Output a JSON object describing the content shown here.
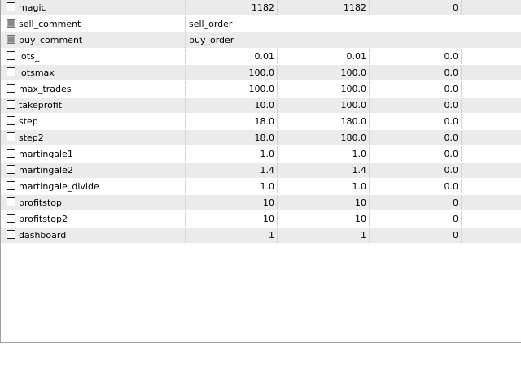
{
  "rows": [
    {
      "name": "magic",
      "value": "1182",
      "start": "1182",
      "step": "0",
      "stop": "",
      "kind": "num",
      "checkbox": "enabled",
      "shaded": true
    },
    {
      "name": "sell_comment",
      "value": "sell_order",
      "start": "",
      "step": "",
      "stop": "",
      "kind": "text",
      "checkbox": "disabled",
      "shaded": false
    },
    {
      "name": "buy_comment",
      "value": "buy_order",
      "start": "",
      "step": "",
      "stop": "",
      "kind": "text",
      "checkbox": "disabled",
      "shaded": true
    },
    {
      "name": "lots_",
      "value": "0.01",
      "start": "0.01",
      "step": "0.0",
      "stop": "",
      "kind": "num",
      "checkbox": "enabled",
      "shaded": false
    },
    {
      "name": "lotsmax",
      "value": "100.0",
      "start": "100.0",
      "step": "0.0",
      "stop": "",
      "kind": "num",
      "checkbox": "enabled",
      "shaded": true
    },
    {
      "name": "max_trades",
      "value": "100.0",
      "start": "100.0",
      "step": "0.0",
      "stop": "",
      "kind": "num",
      "checkbox": "enabled",
      "shaded": false
    },
    {
      "name": "takeprofit",
      "value": "10.0",
      "start": "100.0",
      "step": "0.0",
      "stop": "",
      "kind": "num",
      "checkbox": "enabled",
      "shaded": true
    },
    {
      "name": "step",
      "value": "18.0",
      "start": "180.0",
      "step": "0.0",
      "stop": "",
      "kind": "num",
      "checkbox": "enabled",
      "shaded": false
    },
    {
      "name": "step2",
      "value": "18.0",
      "start": "180.0",
      "step": "0.0",
      "stop": "",
      "kind": "num",
      "checkbox": "enabled",
      "shaded": true
    },
    {
      "name": "martingale1",
      "value": "1.0",
      "start": "1.0",
      "step": "0.0",
      "stop": "",
      "kind": "num",
      "checkbox": "enabled",
      "shaded": false
    },
    {
      "name": "martingale2",
      "value": "1.4",
      "start": "1.4",
      "step": "0.0",
      "stop": "",
      "kind": "num",
      "checkbox": "enabled",
      "shaded": true
    },
    {
      "name": "martingale_divide",
      "value": "1.0",
      "start": "1.0",
      "step": "0.0",
      "stop": "",
      "kind": "num",
      "checkbox": "enabled",
      "shaded": false
    },
    {
      "name": "profitstop",
      "value": "10",
      "start": "10",
      "step": "0",
      "stop": "",
      "kind": "num",
      "checkbox": "enabled",
      "shaded": true
    },
    {
      "name": "profitstop2",
      "value": "10",
      "start": "10",
      "step": "0",
      "stop": "",
      "kind": "num",
      "checkbox": "enabled",
      "shaded": false
    },
    {
      "name": "dashboard",
      "value": "1",
      "start": "1",
      "step": "0",
      "stop": "",
      "kind": "num",
      "checkbox": "enabled",
      "shaded": true
    }
  ]
}
